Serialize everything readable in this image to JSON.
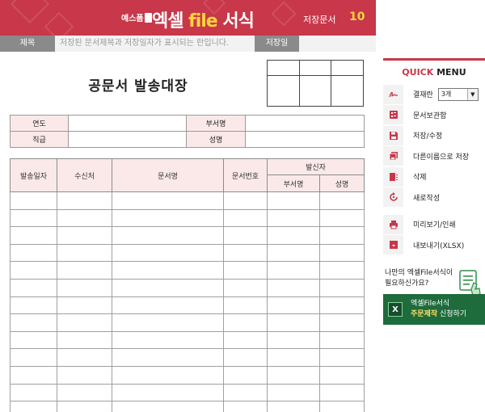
{
  "header": {
    "badge": "예스폼",
    "title_main": "엑셀 ",
    "title_file": "file",
    "title_tail": " 서식",
    "saved_label": "저장문서",
    "saved_count": "10"
  },
  "titlebar": {
    "title_label": "제목",
    "title_placeholder": "저장된 문서제목과 저장일자가 표시되는 란입니다.",
    "date_label": "저장일"
  },
  "sheet": {
    "title": "공문서 발송대장",
    "info": {
      "year_label": "연도",
      "department_label": "부서명",
      "rank_label": "직급",
      "name_label": "성명"
    },
    "table": {
      "columns": [
        "발송일자",
        "수신처",
        "문서명",
        "문서번호"
      ],
      "sender_header": "발신자",
      "sender_sub": [
        "부서명",
        "성명"
      ],
      "row_count": 13
    }
  },
  "quick_menu": {
    "title_q": "QUICK",
    "title_rest": " MENU",
    "approval_label": "결재란",
    "approval_value": "3개",
    "items": [
      {
        "label": "문서보관함",
        "icon": "archive-icon"
      },
      {
        "label": "저장/수정",
        "icon": "save-icon"
      },
      {
        "label": "다른이름으로 저장",
        "icon": "save-as-icon"
      },
      {
        "label": "삭제",
        "icon": "delete-icon"
      },
      {
        "label": "새로작성",
        "icon": "new-document-icon"
      }
    ],
    "output_items": [
      {
        "label": "미리보기/인쇄",
        "icon": "print-icon"
      },
      {
        "label": "내보내기(XLSX)",
        "icon": "export-icon"
      }
    ]
  },
  "promo": {
    "question_line1": "나만의 엑셀File서식이",
    "question_line2": "필요하신가요?",
    "button_line1": "엑셀File서식",
    "button_highlight": "주문제작",
    "button_tail": " 신청하기"
  },
  "colors": {
    "brand": "#c8374a",
    "accent_yellow": "#ffd43b",
    "header_fill": "#fbe9e9",
    "promo_green": "#1e6b3c"
  }
}
